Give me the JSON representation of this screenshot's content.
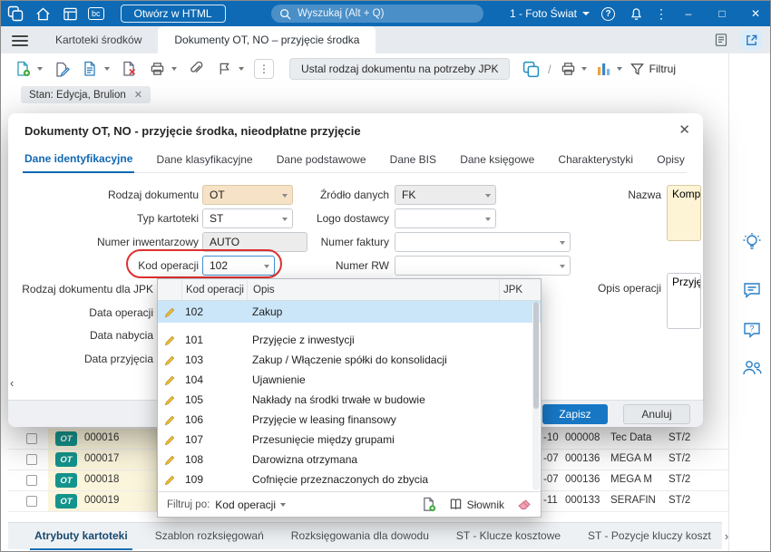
{
  "titlebar": {
    "bc_badge": "bc",
    "open_html_button": "Otwórz w HTML",
    "search_placeholder": "Wyszukaj (Alt + Q)",
    "user_menu": "1 - Foto Świat"
  },
  "tabbar": {
    "tab_kartoteki": "Kartoteki środków",
    "tab_dokumenty": "Dokumenty OT, NO – przyjęcie środka"
  },
  "toolbar": {
    "jpk_button": "Ustal rodzaj dokumentu na potrzeby JPK",
    "filter_button": "Filtruj"
  },
  "filter_chip": {
    "label": "Stan: Edycja, Brulion"
  },
  "dialog": {
    "title": "Dokumenty OT, NO - przyjęcie środka, nieodpłatne przyjęcie",
    "tabs": [
      "Dane identyfikacyjne",
      "Dane klasyfikacyjne",
      "Dane podstawowe",
      "Dane BIS",
      "Dane księgowe",
      "Charakterystyki",
      "Opisy"
    ],
    "fields": {
      "rodzaj_dokumentu": {
        "label": "Rodzaj dokumentu",
        "value": "OT"
      },
      "typ_kartoteki": {
        "label": "Typ kartoteki",
        "value": "ST"
      },
      "numer_inwentarzowy": {
        "label": "Numer inwentarzowy",
        "value": "AUTO"
      },
      "kod_operacji": {
        "label": "Kod operacji",
        "value": "102"
      },
      "rodzaj_dokumentu_jpk": {
        "label": "Rodzaj dokumentu dla JPK"
      },
      "data_operacji": {
        "label": "Data operacji"
      },
      "data_nabycia": {
        "label": "Data nabycia"
      },
      "data_przyjecia": {
        "label": "Data przyjęcia"
      },
      "zrodlo_danych": {
        "label": "Źródło danych",
        "value": "FK"
      },
      "logo_dostawcy": {
        "label": "Logo dostawcy",
        "value": ""
      },
      "numer_faktury": {
        "label": "Numer faktury",
        "value": ""
      },
      "numer_rw": {
        "label": "Numer RW",
        "value": ""
      },
      "nazwa": {
        "label": "Nazwa",
        "value": "Komp"
      },
      "opis_operacji": {
        "label": "Opis operacji",
        "value": "Przyję"
      }
    },
    "footer": {
      "save": "Zapisz",
      "cancel": "Anuluj"
    }
  },
  "dropdown": {
    "columns": {
      "kod": "Kod operacji",
      "opis": "Opis",
      "jpk": "JPK"
    },
    "selected_row": {
      "kod": "102",
      "opis": "Zakup"
    },
    "rows": [
      {
        "kod": "101",
        "opis": "Przyjęcie z inwestycji"
      },
      {
        "kod": "103",
        "opis": "Zakup / Włączenie spółki do konsolidacji"
      },
      {
        "kod": "104",
        "opis": "Ujawnienie"
      },
      {
        "kod": "105",
        "opis": "Nakłady na środki trwałe w budowie"
      },
      {
        "kod": "106",
        "opis": "Przyjęcie w leasing finansowy"
      },
      {
        "kod": "107",
        "opis": "Przesunięcie między grupami"
      },
      {
        "kod": "108",
        "opis": "Darowizna otrzymana"
      },
      {
        "kod": "109",
        "opis": "Cofnięcie przeznaczonych do zbycia"
      }
    ],
    "footer": {
      "filter_by_label": "Filtruj po:",
      "filter_by_value": "Kod operacji",
      "dictionary_button": "Słownik"
    }
  },
  "records": {
    "left": [
      {
        "badge": "OT",
        "number": "000016"
      },
      {
        "badge": "OT",
        "number": "000017"
      },
      {
        "badge": "OT",
        "number": "000018"
      },
      {
        "badge": "OT",
        "number": "000019"
      }
    ],
    "right": [
      {
        "date_fragment": "-10",
        "code": "000008",
        "contractor": "Tec Data",
        "type": "ST/2"
      },
      {
        "date_fragment": "-07",
        "code": "000136",
        "contractor": "MEGA M",
        "type": "ST/2"
      },
      {
        "date_fragment": "-07",
        "code": "000136",
        "contractor": "MEGA M",
        "type": "ST/2"
      },
      {
        "date_fragment": "-11",
        "code": "000133",
        "contractor": "SERAFIN",
        "type": "ST/2"
      }
    ]
  },
  "bottom_tabs": [
    "Atrybuty kartoteki",
    "Szablon rozksięgowań",
    "Rozksięgowania dla dowodu",
    "ST - Klucze kosztowe",
    "ST - Pozycje kluczy koszt"
  ],
  "colors": {
    "titlebar": "#0e6ab4",
    "accent": "#1777c4",
    "selected_row": "#cbe6f9",
    "focus_ring": "#df3030",
    "badge_teal": "#13948c"
  }
}
